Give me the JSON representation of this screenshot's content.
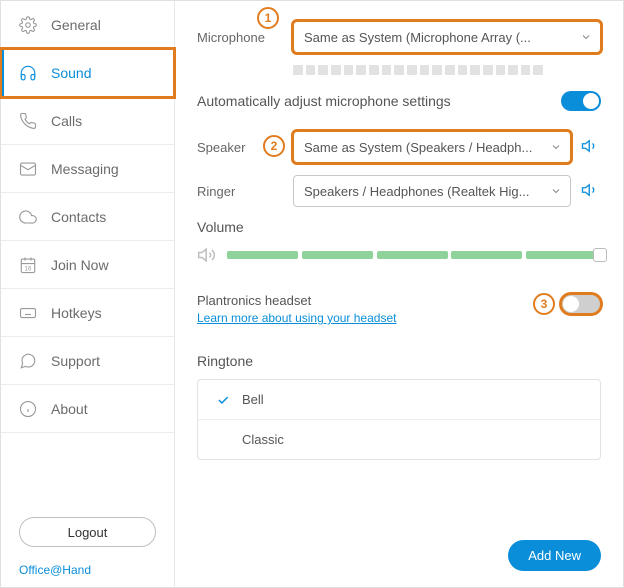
{
  "sidebar": {
    "items": [
      {
        "label": "General",
        "icon": "gear-icon"
      },
      {
        "label": "Sound",
        "icon": "headphones-icon",
        "active": true
      },
      {
        "label": "Calls",
        "icon": "phone-icon"
      },
      {
        "label": "Messaging",
        "icon": "envelope-icon"
      },
      {
        "label": "Contacts",
        "icon": "cloud-icon"
      },
      {
        "label": "Join Now",
        "icon": "calendar-icon"
      },
      {
        "label": "Hotkeys",
        "icon": "keyboard-icon"
      },
      {
        "label": "Support",
        "icon": "chat-icon"
      },
      {
        "label": "About",
        "icon": "info-icon"
      }
    ],
    "logout_label": "Logout",
    "brand_label": "Office@Hand"
  },
  "sound": {
    "microphone_label": "Microphone",
    "microphone_value": "Same as System (Microphone Array (...",
    "auto_adjust_label": "Automatically adjust microphone settings",
    "auto_adjust_on": true,
    "speaker_label": "Speaker",
    "speaker_value": "Same as System (Speakers / Headph...",
    "ringer_label": "Ringer",
    "ringer_value": "Speakers / Headphones (Realtek Hig...",
    "volume_label": "Volume",
    "headset_label": "Plantronics headset",
    "headset_link": "Learn more about using your headset",
    "headset_on": false,
    "ringtone_label": "Ringtone",
    "ringtones": [
      {
        "label": "Bell",
        "selected": true
      },
      {
        "label": "Classic",
        "selected": false
      }
    ],
    "add_new_label": "Add New"
  },
  "callouts": {
    "one": "1",
    "two": "2",
    "three": "3"
  }
}
